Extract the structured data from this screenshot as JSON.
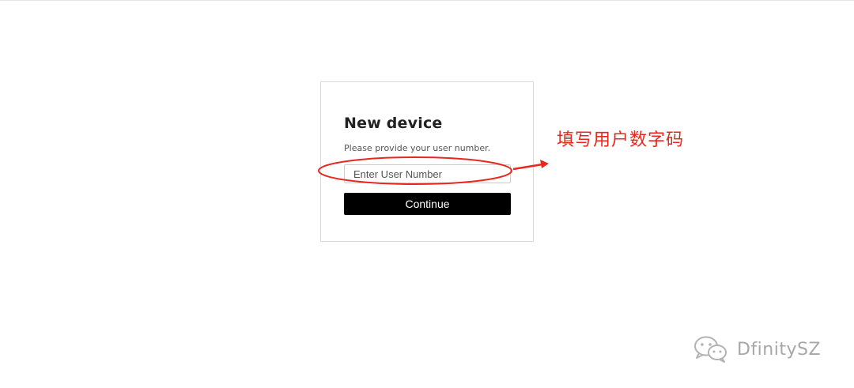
{
  "login_card": {
    "title": "New device",
    "subtitle": "Please provide your user number.",
    "user_number_placeholder": "Enter User Number",
    "user_number_value": "",
    "continue_label": "Continue"
  },
  "annotation": {
    "text": "填写用户数字码",
    "color": "#e8281e"
  },
  "watermark": {
    "icon": "wechat-icon",
    "text": "DfinitySZ"
  },
  "colors": {
    "button_bg": "#000000",
    "button_text": "#ffffff",
    "card_border": "#d9d9d9",
    "title": "#222222"
  }
}
